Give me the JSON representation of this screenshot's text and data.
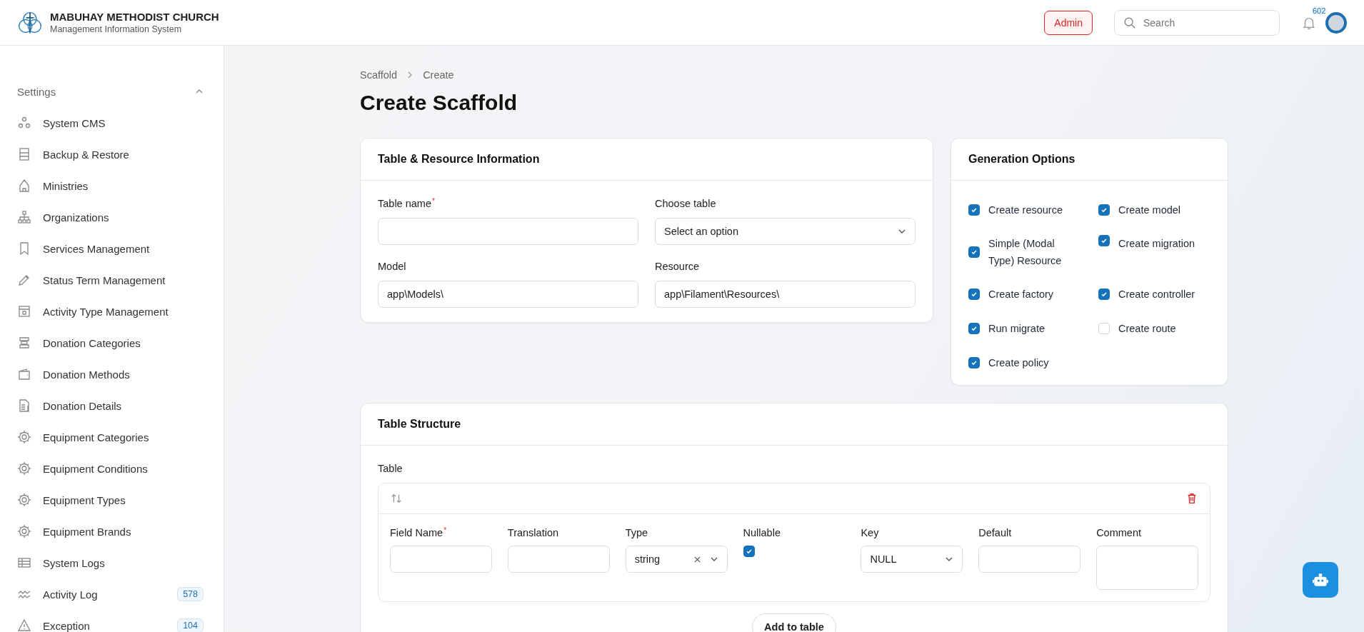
{
  "header": {
    "title": "MABUHAY METHODIST CHURCH",
    "subtitle": "Management Information System",
    "role": "Admin",
    "search": {
      "placeholder": "Search"
    },
    "notifications": "602"
  },
  "sidebar": {
    "group": "Settings",
    "expanded": true,
    "items": [
      {
        "label": "System CMS"
      },
      {
        "label": "Backup & Restore"
      },
      {
        "label": "Ministries"
      },
      {
        "label": "Organizations"
      },
      {
        "label": "Services Management"
      },
      {
        "label": "Status Term Management"
      },
      {
        "label": "Activity Type Management"
      },
      {
        "label": "Donation Categories"
      },
      {
        "label": "Donation Methods"
      },
      {
        "label": "Donation Details"
      },
      {
        "label": "Equipment Categories"
      },
      {
        "label": "Equipment Conditions"
      },
      {
        "label": "Equipment Types"
      },
      {
        "label": "Equipment Brands"
      },
      {
        "label": "System Logs"
      },
      {
        "label": "Activity Log",
        "badge": "578"
      },
      {
        "label": "Exception",
        "badge": "104"
      }
    ]
  },
  "breadcrumbs": [
    "Scaffold",
    "Create"
  ],
  "page_title": "Create Scaffold",
  "resource_info": {
    "title": "Table & Resource Information",
    "fields": [
      {
        "label": "Table name",
        "required_mark": "*",
        "kind": "text"
      },
      {
        "label": "Choose table",
        "kind": "select",
        "placeholder": "Select an option"
      },
      {
        "label": "Model",
        "kind": "text",
        "value": "app\\Models\\"
      },
      {
        "label": "Resource",
        "kind": "text",
        "value": "app\\Filament\\Resources\\"
      }
    ]
  },
  "generation_options": {
    "title": "Generation Options",
    "options": [
      {
        "label": "Create resource",
        "checked": true
      },
      {
        "label": "Create model",
        "checked": true
      },
      {
        "label": "Simple (Modal Type) Resource",
        "checked": true
      },
      {
        "label": "Create migration",
        "checked": true
      },
      {
        "label": "Create factory",
        "checked": true
      },
      {
        "label": "Create controller",
        "checked": true
      },
      {
        "label": "Run migrate",
        "checked": true
      },
      {
        "label": "Create route",
        "checked": false
      },
      {
        "label": "Create policy",
        "checked": true
      }
    ]
  },
  "table_structure": {
    "title": "Table Structure",
    "label": "Table",
    "columns": [
      {
        "label": "Field Name",
        "required_mark": "*",
        "kind": "text"
      },
      {
        "label": "Translation",
        "kind": "text"
      },
      {
        "label": "Type",
        "kind": "select",
        "value": "string",
        "clearable": true
      },
      {
        "label": "Nullable",
        "kind": "checkbox",
        "checked": true
      },
      {
        "label": "Key",
        "kind": "select",
        "value": "NULL",
        "clearable": false
      },
      {
        "label": "Default",
        "kind": "text"
      },
      {
        "label": "Comment",
        "kind": "textarea"
      }
    ],
    "add_button": "Add to table"
  }
}
